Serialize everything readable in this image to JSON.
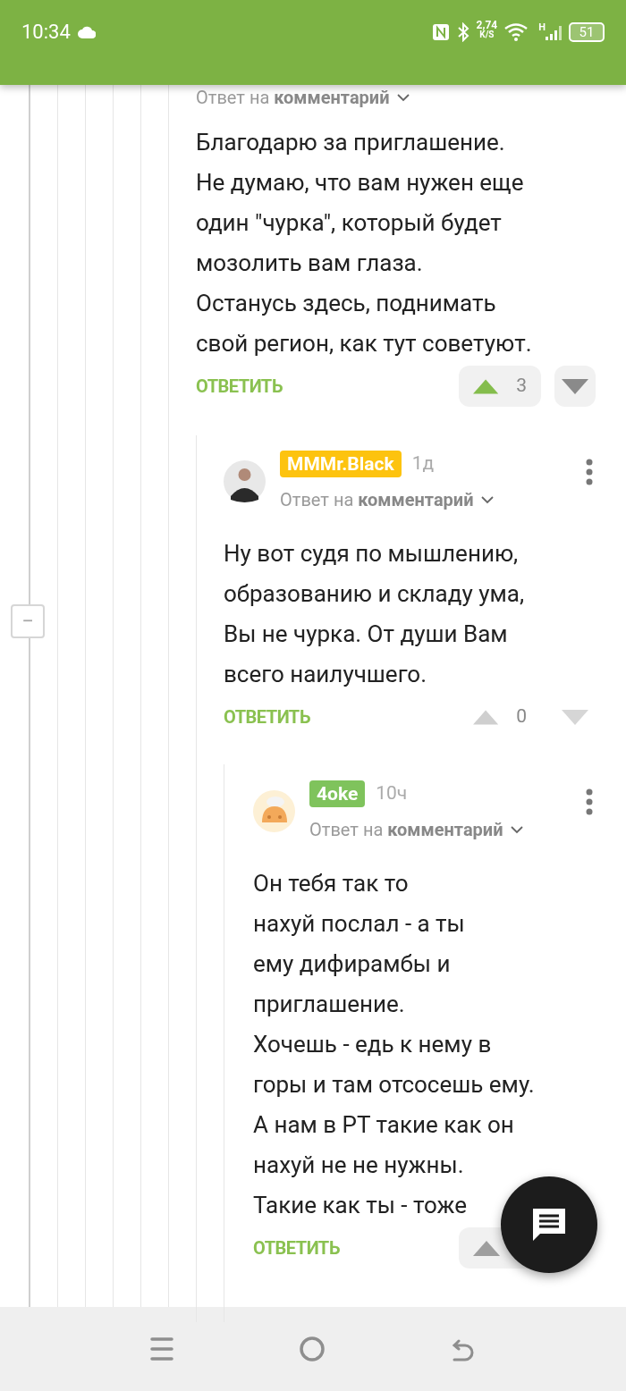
{
  "status_bar": {
    "time": "10:34",
    "net_speed": "2,74",
    "net_unit": "K/S",
    "signal_type": "H",
    "battery": "51"
  },
  "thread": {
    "collapse_label": "−"
  },
  "comments": [
    {
      "reply_label": "Ответ на **комментарий**",
      "body": "Благодарю за приглашение.\nНе думаю, что вам нужен еще\nодин \"чурка\", который будет\nмозолить вам глаза.\nОстанусь здесь, поднимать\nсвой регион, как тут советуют.",
      "reply_button": "ОТВЕТИТЬ",
      "vote": {
        "upvoted": true,
        "score": "3",
        "boxed": true
      }
    },
    {
      "author": "MMMr.Black",
      "color": "#fdc30f",
      "time": "1д",
      "avatar": {
        "kind": "person"
      },
      "reply_label": "Ответ на **комментарий**",
      "body": "Ну вот судя по мышлению,\nобразованию и складу ума,\nВы не чурка. От души Вам\nвсего наилучшего.",
      "reply_button": "ОТВЕТИТЬ",
      "vote": {
        "upvoted": false,
        "score": "0",
        "boxed": false
      }
    },
    {
      "author": "4oke",
      "color": "#7fc35c",
      "time": "10ч",
      "avatar": {
        "kind": "bun"
      },
      "reply_label": "Ответ на **комментарий**",
      "body": "Он тебя так то\nнахуй послал - а ты\nему дифирамбы и\nприглашение.\nХочешь - едь к нему в\nгоры и там отсосешь ему.\nА нам в РТ такие как он\nнахуй не не нужны.\nТакие как ты - тоже",
      "reply_button": "ОТВЕТИТЬ",
      "vote": {
        "upvoted": false,
        "boxed": true
      }
    }
  ]
}
